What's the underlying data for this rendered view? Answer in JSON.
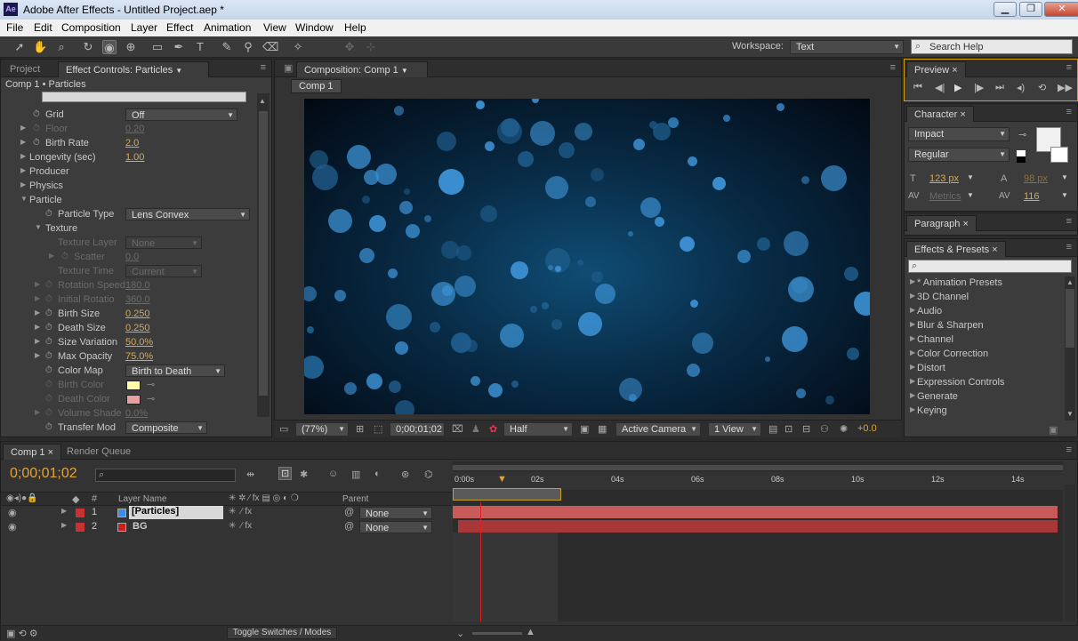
{
  "app": {
    "title": "Adobe After Effects - Untitled Project.aep *",
    "logo": "Ae"
  },
  "window_buttons": {
    "minimize": "▁",
    "maximize": "❐",
    "close": "✕"
  },
  "menu": [
    "File",
    "Edit",
    "Composition",
    "Layer",
    "Effect",
    "Animation",
    "View",
    "Window",
    "Help"
  ],
  "toolbar": {
    "workspace_label": "Workspace:",
    "workspace_value": "Text",
    "search_placeholder": "Search Help"
  },
  "project_panel": {
    "tabs": [
      "Project",
      "Effect Controls: Particles"
    ],
    "breadcrumb": "Comp 1 • Particles",
    "rows": [
      {
        "label": "Grid",
        "value": "Off",
        "type": "dropdown",
        "dim": false
      },
      {
        "label": "Floor",
        "value": "0.20",
        "dim": true
      },
      {
        "label": "Birth Rate",
        "value": "2.0",
        "dim": false
      },
      {
        "label": "Longevity (sec)",
        "value": "1.00",
        "dim": false
      },
      {
        "label": "Producer",
        "value": "",
        "dim": false
      },
      {
        "label": "Physics",
        "value": "",
        "dim": false
      },
      {
        "label": "Particle",
        "value": "",
        "dim": false
      },
      {
        "label": "Particle Type",
        "value": "Lens Convex",
        "type": "dropdown",
        "dim": false
      },
      {
        "label": "Texture",
        "value": "",
        "dim": false
      },
      {
        "label": "Texture Layer",
        "value": "None",
        "type": "dropdown",
        "dim": true
      },
      {
        "label": "Scatter",
        "value": "0.0",
        "dim": true
      },
      {
        "label": "Texture Time",
        "value": "Current",
        "type": "dropdown",
        "dim": true
      },
      {
        "label": "Rotation Speed",
        "value": "180.0",
        "dim": true
      },
      {
        "label": "Initial Rotatio",
        "value": "360.0",
        "dim": true
      },
      {
        "label": "Birth Size",
        "value": "0.250",
        "dim": false
      },
      {
        "label": "Death Size",
        "value": "0.250",
        "dim": false
      },
      {
        "label": "Size Variation",
        "value": "50.0%",
        "dim": false
      },
      {
        "label": "Max Opacity",
        "value": "75.0%",
        "dim": false
      },
      {
        "label": "Color Map",
        "value": "Birth to Death",
        "type": "dropdown",
        "dim": false
      },
      {
        "label": "Birth Color",
        "value": "",
        "dim": true
      },
      {
        "label": "Death Color",
        "value": "",
        "dim": true
      },
      {
        "label": "Volume Shade",
        "value": "0.0%",
        "dim": true
      },
      {
        "label": "Transfer Mod",
        "value": "Composite",
        "type": "dropdown",
        "dim": false
      }
    ],
    "birth_color": "#fffba8",
    "death_color": "#e6a0a0"
  },
  "composition": {
    "tab": "Composition: Comp 1",
    "sub_tab": "Comp 1",
    "zoom": "(77%)",
    "timecode": "0;00;01;02",
    "resolution": "Half",
    "camera": "Active Camera",
    "views": "1 View",
    "exposure": "+0.0"
  },
  "preview": {
    "tab": "Preview"
  },
  "character": {
    "tab": "Character",
    "font": "Impact",
    "style": "Regular",
    "size": "123 px",
    "leading": "98 px",
    "kerning": "Metrics",
    "tracking": "116"
  },
  "paragraph": {
    "tab": "Paragraph"
  },
  "effects_presets": {
    "tab": "Effects & Presets",
    "items": [
      "* Animation Presets",
      "3D Channel",
      "Audio",
      "Blur & Sharpen",
      "Channel",
      "Color Correction",
      "Distort",
      "Expression Controls",
      "Generate",
      "Keying"
    ]
  },
  "timeline": {
    "tabs": [
      "Comp 1",
      "Render Queue"
    ],
    "timecode": "0;00;01;02",
    "col_layer_name": "Layer Name",
    "col_parent": "Parent",
    "ruler": [
      "0:00s",
      "02s",
      "04s",
      "06s",
      "08s",
      "10s",
      "12s",
      "14s"
    ],
    "layers": [
      {
        "num": "1",
        "name": "[Particles]",
        "color": "#3a8ee6",
        "label_color": "#c83232",
        "parent": "None"
      },
      {
        "num": "2",
        "name": "BG",
        "color": "#c81e1e",
        "label_color": "#c83232",
        "parent": "None"
      }
    ],
    "toggle_label": "Toggle Switches / Modes"
  }
}
